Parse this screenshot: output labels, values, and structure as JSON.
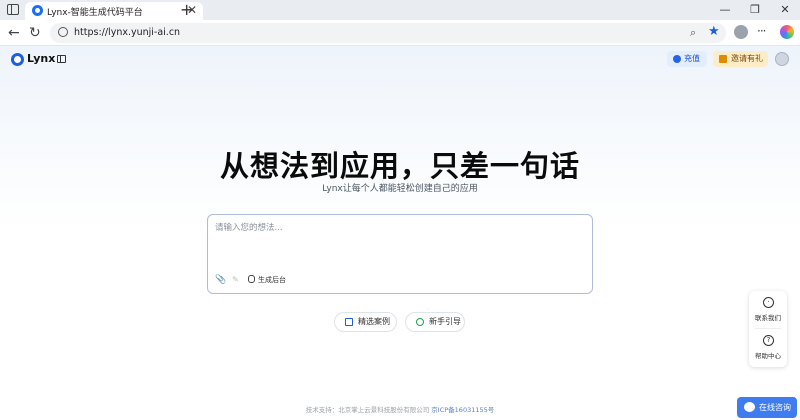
{
  "browser": {
    "tab_title": "Lynx-智能生成代码平台",
    "tab_close": "✕",
    "new_tab": "+",
    "url": "https://lynx.yunji-ai.cn",
    "win_min": "—",
    "win_max": "❐",
    "win_close": "✕"
  },
  "header": {
    "logo_text": "Lynx",
    "recharge_label": "充值",
    "invite_label": "邀请有礼"
  },
  "hero": {
    "title": "从想法到应用，只差一句话",
    "subtitle": "Lynx让每个人都能轻松创建自己的应用"
  },
  "prompt": {
    "placeholder": "请输入您的想法...",
    "generate_backend_label": "生成后台"
  },
  "chips": [
    {
      "label": "精选案例"
    },
    {
      "label": "新手引导"
    }
  ],
  "float_panel": {
    "contact_label": "联系我们",
    "help_label": "帮助中心"
  },
  "footer": {
    "support_text": "技术支持：北京掌上云景科技股份有限公司",
    "icp": "京ICP备16031155号"
  },
  "chat_button": {
    "label": "在线咨询"
  },
  "colors": {
    "brand": "#1b5fe0",
    "chat_button": "#3f7cf0",
    "invite_bg": "#fdecc8"
  }
}
